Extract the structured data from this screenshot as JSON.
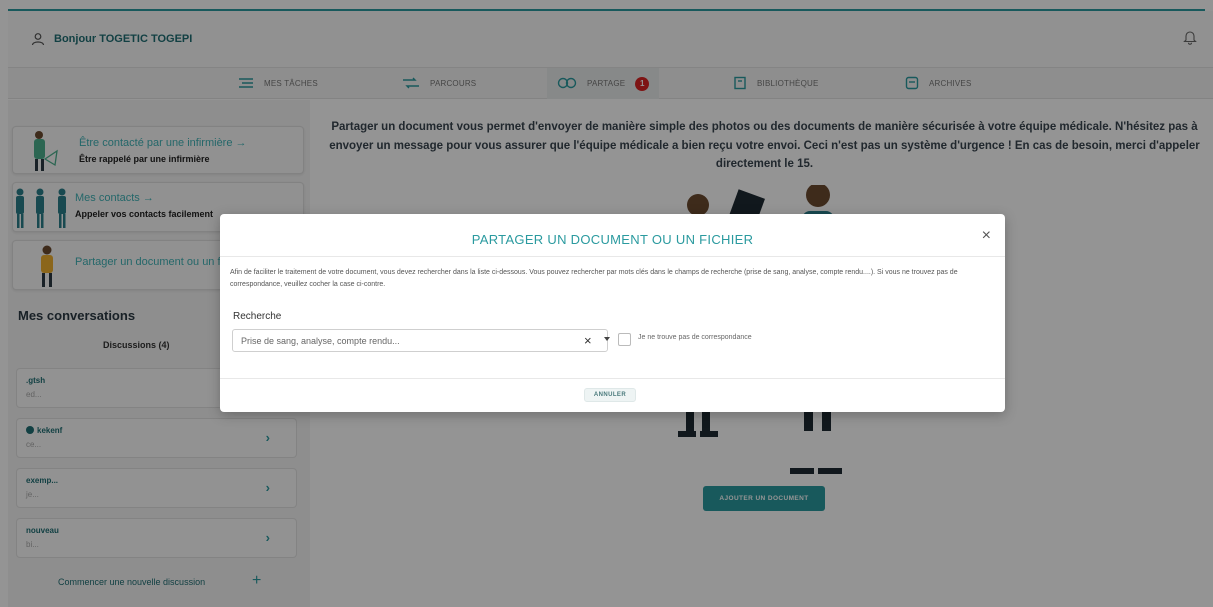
{
  "header": {
    "greeting": "Bonjour TOGETIC TOGEPI",
    "icons": {
      "user": "user-icon",
      "bell": "bell-icon"
    }
  },
  "nav": {
    "items": [
      {
        "label": "MES TÂCHES",
        "icon": "list-icon"
      },
      {
        "label": "PARCOURS",
        "icon": "route-icon"
      },
      {
        "label": "PARTAGE",
        "icon": "share-icon",
        "badge": "1",
        "active": true
      },
      {
        "label": "BIBLIOTHÈQUE",
        "icon": "library-icon"
      },
      {
        "label": "ARCHIVES",
        "icon": "archive-icon"
      }
    ]
  },
  "sidebar": {
    "cards": [
      {
        "title": "Être contacté par une infirmière →",
        "subtitle": "Être rappelé par une infirmière"
      },
      {
        "title": "Mes contacts →",
        "subtitle": "Appeler vos contacts facilement"
      },
      {
        "title": "Partager un document ou un fi"
      }
    ],
    "conversations_title": "Mes conversations",
    "discussions_label": "Discussions (4)",
    "conversations": [
      {
        "name": ".gtsh",
        "snippet": "ed..."
      },
      {
        "name": "kekenf",
        "snippet": "ce...",
        "online": true
      },
      {
        "name": "exemp...",
        "snippet": "je..."
      },
      {
        "name": "nouveau",
        "snippet": "bi..."
      }
    ],
    "new_discussion": "Commencer une nouvelle discussion",
    "new_discussion_plus": "+"
  },
  "main": {
    "info_text": "Partager un document vous permet d'envoyer de manière simple des photos ou des documents de manière sécurisée à votre équipe médicale. N'hésitez pas à envoyer un message pour vous assurer que l'équipe médicale a bien reçu votre envoi. Ceci n'est pas un système d'urgence ! En cas de besoin, merci d'appeler directement le 15.",
    "add_button": "AJOUTER UN DOCUMENT"
  },
  "modal": {
    "title": "PARTAGER UN DOCUMENT OU UN FICHIER",
    "close": "×",
    "description": "Afin de faciliter le traitement de votre document, vous devez rechercher dans la liste ci-dessous. Vous pouvez rechercher par mots clés dans le champs de recherche (prise de sang, analyse, compte rendu....). Si vous ne trouvez pas de correspondance, veuillez cocher la case ci-contre.",
    "search_label": "Recherche",
    "search_placeholder": "Prise de sang, analyse, compte rendu...",
    "clear": "×",
    "checkbox_label": "Je ne trouve pas de correspondance",
    "cancel": "ANNULER"
  },
  "colors": {
    "accent": "#2a9a9f",
    "dark_teal": "#1f6f74",
    "badge": "#d92323"
  }
}
